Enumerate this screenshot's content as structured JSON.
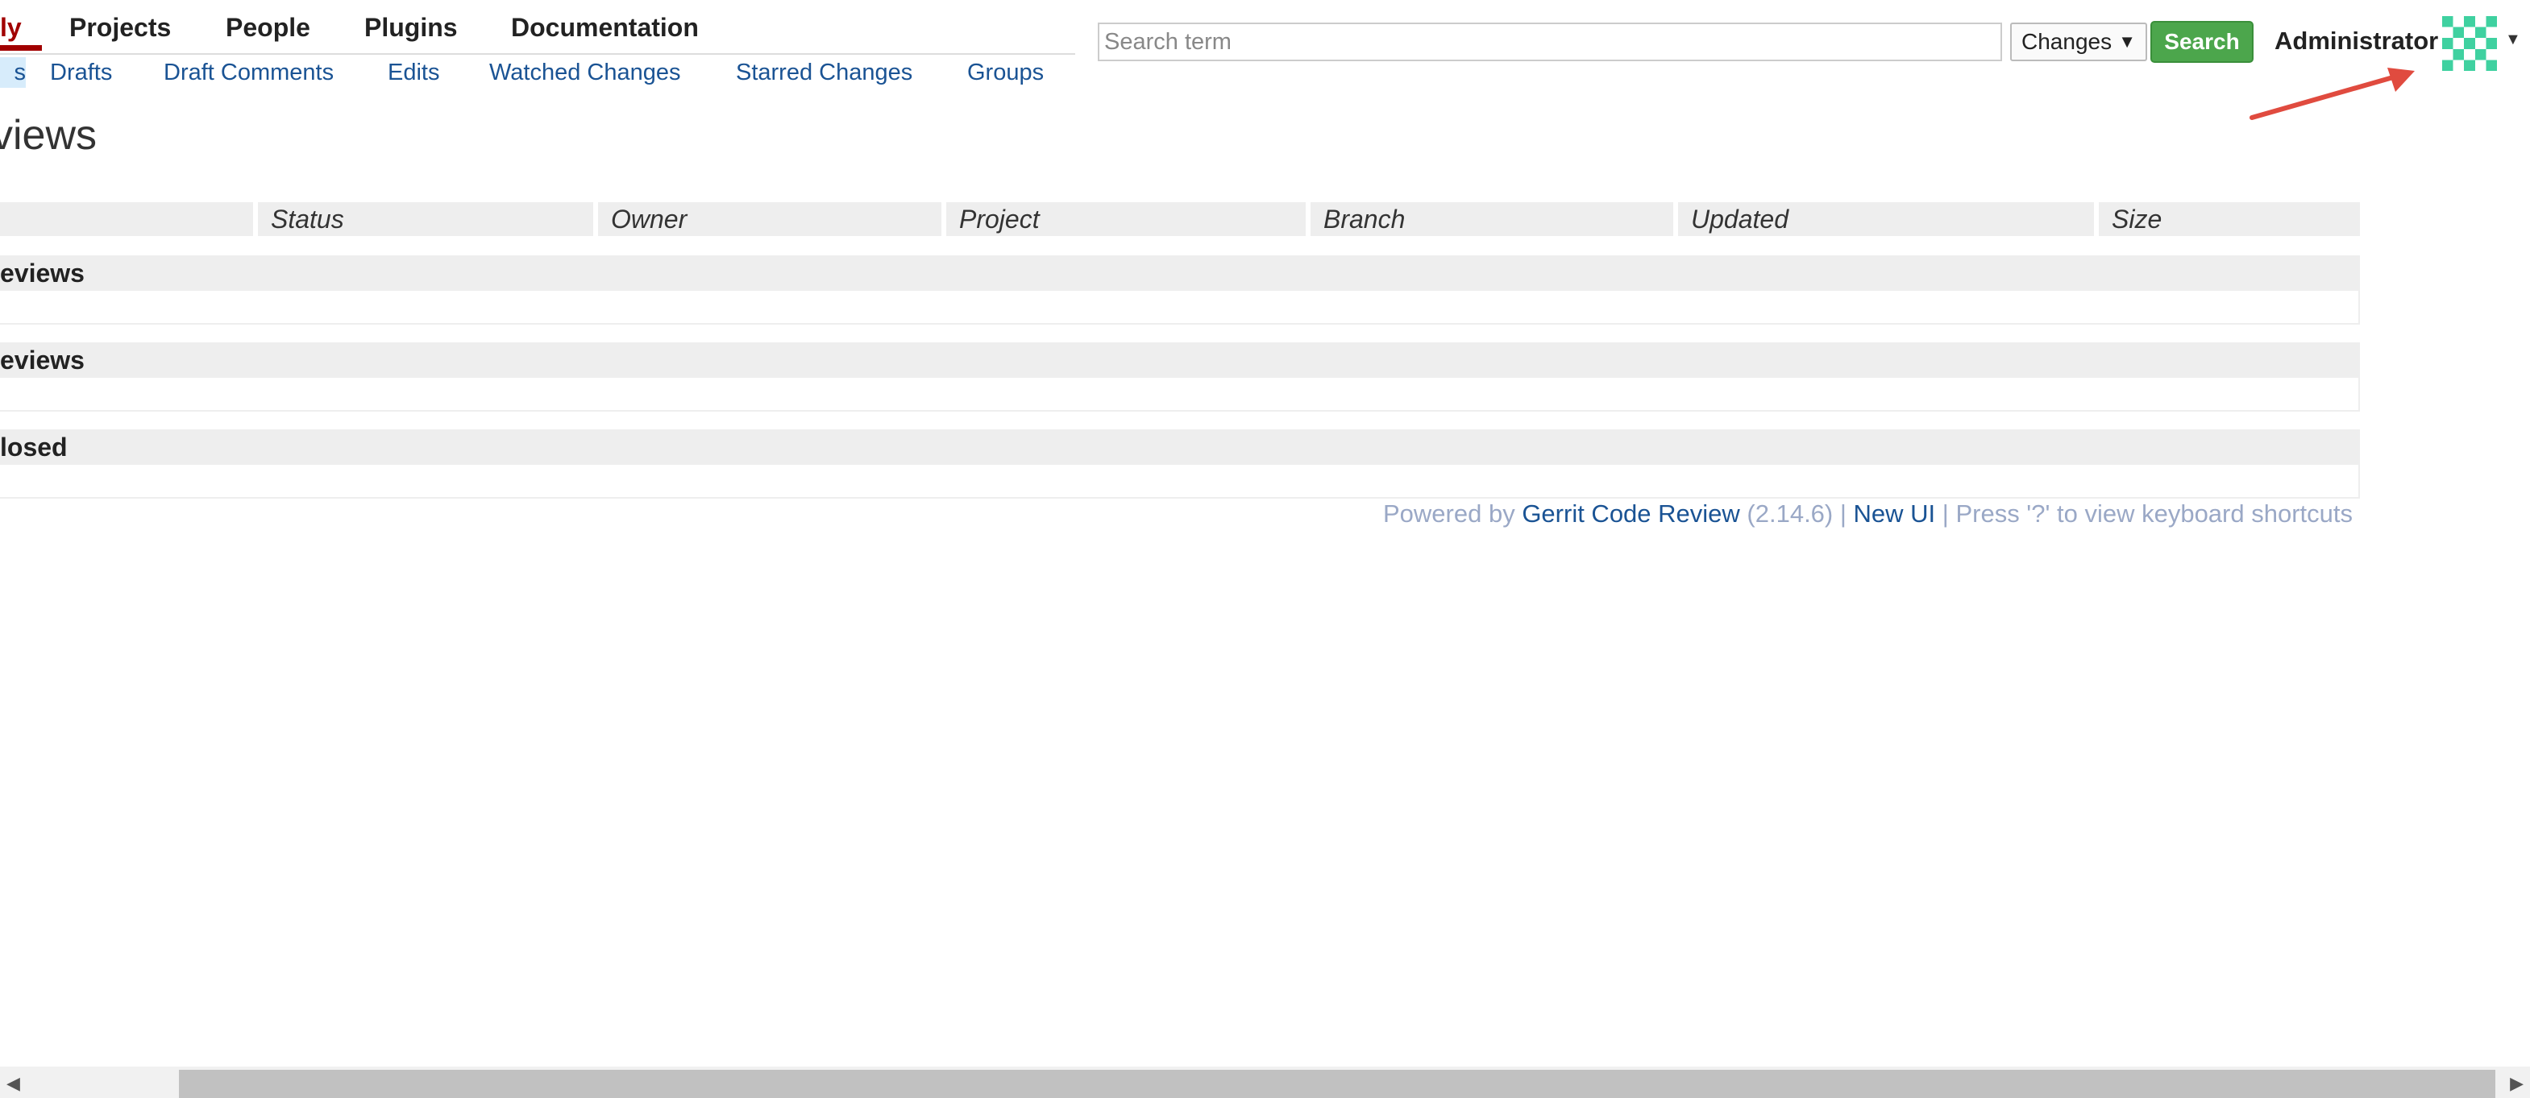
{
  "top_menu": {
    "tabs": [
      {
        "label": "ly",
        "active": true
      },
      {
        "label": "Projects"
      },
      {
        "label": "People"
      },
      {
        "label": "Plugins"
      },
      {
        "label": "Documentation"
      }
    ],
    "sub_tabs": [
      {
        "label": "s",
        "active": true
      },
      {
        "label": "Drafts"
      },
      {
        "label": "Draft Comments"
      },
      {
        "label": "Edits"
      },
      {
        "label": "Watched Changes"
      },
      {
        "label": "Starred Changes"
      },
      {
        "label": "Groups"
      }
    ]
  },
  "search": {
    "placeholder": "Search term",
    "value": "",
    "scope_selected": "Changes",
    "button_label": "Search"
  },
  "user": {
    "name": "Administrator",
    "avatar_icon": "identicon-avatar",
    "caret_icon": "caret-down-icon"
  },
  "page": {
    "title": "views"
  },
  "table": {
    "columns": [
      "Status",
      "Owner",
      "Project",
      "Branch",
      "Updated",
      "Size"
    ],
    "sections": [
      {
        "title": "eviews",
        "rows": []
      },
      {
        "title": "eviews",
        "rows": []
      },
      {
        "title": "losed",
        "rows": []
      }
    ]
  },
  "footer": {
    "powered_by": "Powered by ",
    "gerrit_link": "Gerrit Code Review",
    "version": " (2.14.6) | ",
    "new_ui_link": "New UI",
    "shortcut_hint": " | Press '?' to view keyboard shortcuts"
  },
  "annotation": {
    "arrow_color": "#e04b3f"
  },
  "colors": {
    "active_tab": "#a10000",
    "link": "#1a5394",
    "search_button": "#4ca64c",
    "header_bg": "#eeeeee"
  }
}
